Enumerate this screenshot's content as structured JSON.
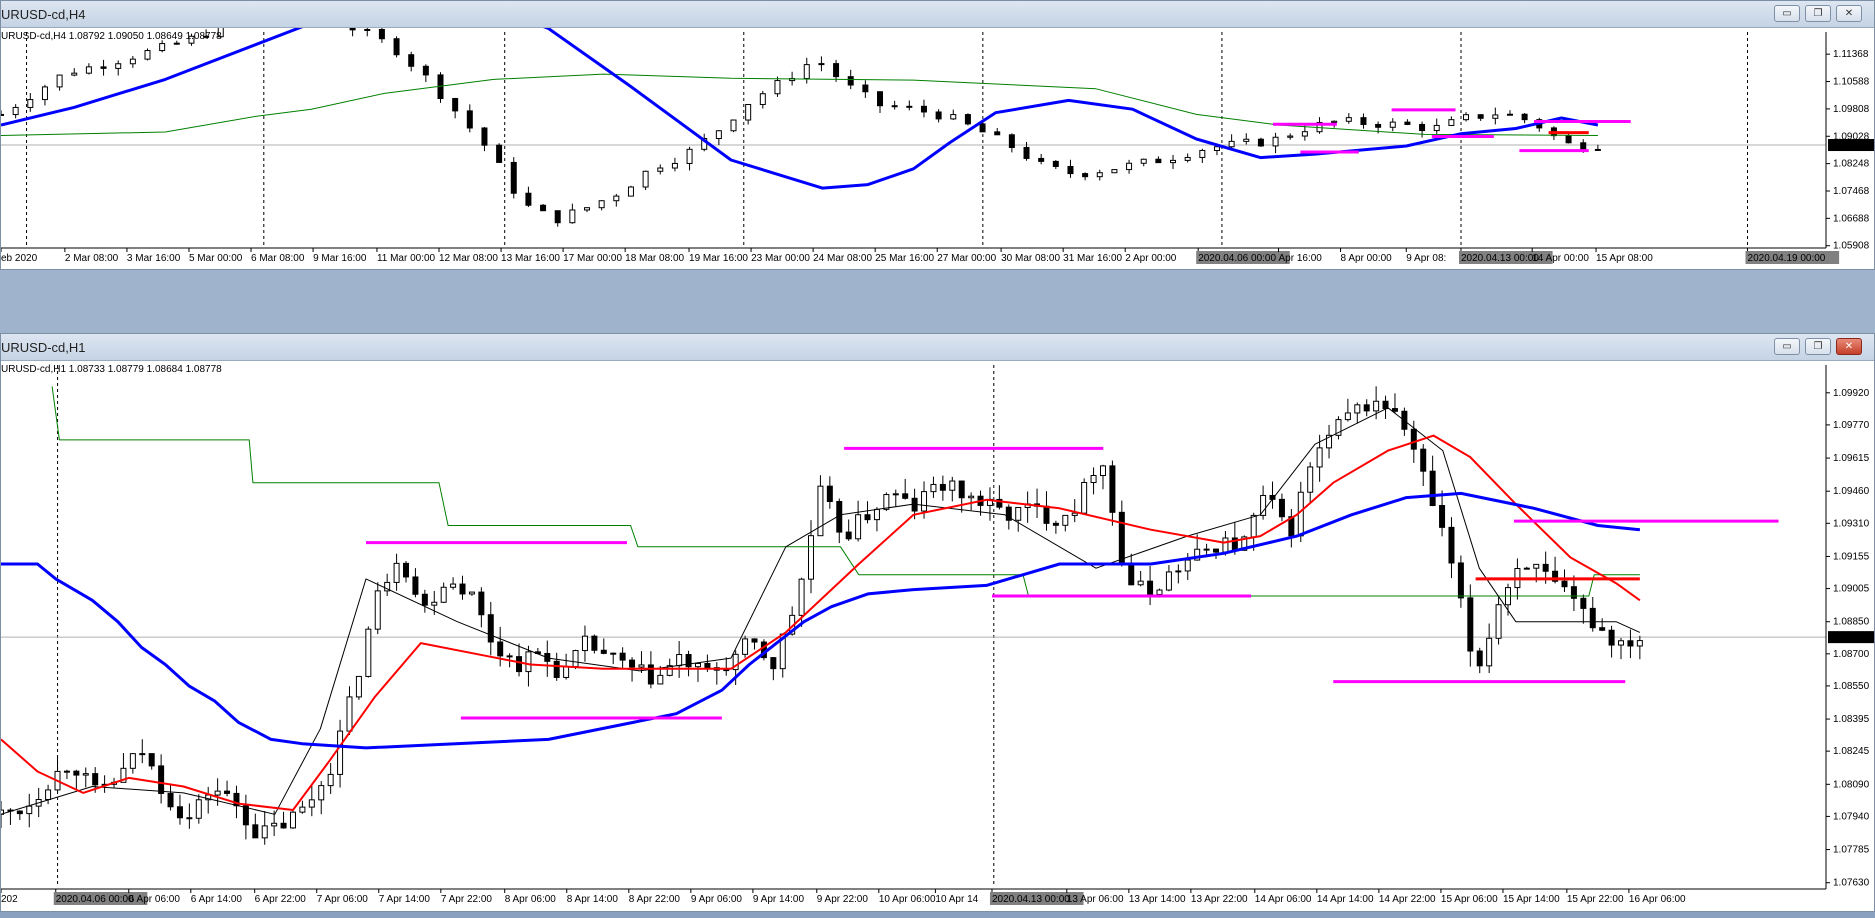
{
  "colors": {
    "bull": "#ffffff",
    "bear": "#000000",
    "ma_blue": "#0000ff",
    "ma_red": "#ff0000",
    "ma_green": "#008000",
    "magenta": "#ff00ff",
    "grid": "#000000",
    "tag_bg": "#808080"
  },
  "top_window": {
    "title": "URUSD-cd,H4",
    "info": "URUSD-cd,H4  1.08792 1.09050 1.08649 1.08778",
    "buttons": {
      "minimize": "▭",
      "restore": "❐",
      "close": "✕"
    },
    "chart_data": {
      "type": "candlestick",
      "symbol": "URUSD-cd,H4",
      "ohlc_last": {
        "open": 1.08792,
        "high": 1.0905,
        "low": 1.08649,
        "close": 1.08778
      },
      "current_price": "1.08778",
      "ylim": [
        1.059,
        1.12
      ],
      "y_ticks": [
        "1.11368",
        "1.10588",
        "1.09808",
        "1.09028",
        "1.08248",
        "1.07468",
        "1.06688",
        "1.05908"
      ],
      "x_ticks": [
        "eb 2020",
        "2 Mar 08:00",
        "3 Mar 16:00",
        "5 Mar 00:00",
        "6 Mar 08:00",
        "9 Mar 16:00",
        "11 Mar 00:00",
        "12 Mar 08:00",
        "13 Mar 16:00",
        "17 Mar 00:00",
        "18 Mar 08:00",
        "19 Mar 16:00",
        "23 Mar 00:00",
        "24 Mar 08:00",
        "25 Mar 16:00",
        "27 Mar 00:00",
        "30 Mar 08:00",
        "31 Mar 16:00",
        "2 Apr 00:00",
        "2020.04.06 00:00",
        "Apr 16:00",
        "8 Apr 00:00",
        "9 Apr 08:",
        "2020.04.13 00:00",
        "14 Apr 00:00",
        "15 Apr 08:00",
        "2020.04.19 00:00"
      ],
      "x_tick_pos": [
        0,
        0.035,
        0.069,
        0.103,
        0.137,
        0.171,
        0.206,
        0.24,
        0.274,
        0.308,
        0.342,
        0.377,
        0.411,
        0.445,
        0.479,
        0.513,
        0.548,
        0.582,
        0.616,
        0.656,
        0.7,
        0.734,
        0.77,
        0.8,
        0.839,
        0.874,
        0.957
      ],
      "highlighted_ticks": [
        "2020.04.06 00:00",
        "2020.04.13 00:00",
        "2020.04.19 00:00"
      ],
      "vlines_frac": [
        0.014,
        0.144,
        0.276,
        0.407,
        0.538,
        0.669,
        0.8,
        0.957
      ],
      "price_path": [
        1.0965,
        1.1025,
        1.1085,
        1.1105,
        1.113,
        1.1155,
        1.1185,
        1.123,
        1.1255,
        1.1245,
        1.124,
        1.1205,
        1.116,
        1.1075,
        1.097,
        1.086,
        1.071,
        1.0665,
        1.07,
        1.0745,
        1.0815,
        1.085,
        1.092,
        1.1005,
        1.106,
        1.1125,
        1.1045,
        1.099,
        1.098,
        1.096,
        1.092,
        1.0875,
        1.0815,
        1.0795,
        1.081,
        1.0825,
        1.0845,
        1.087,
        1.088,
        1.089,
        1.0925,
        1.0945,
        1.094,
        1.0935,
        1.0925,
        1.0955,
        1.097,
        1.0945,
        1.088,
        1.0878
      ],
      "blue_ma": [
        [
          0,
          1.0935
        ],
        [
          0.04,
          1.0985
        ],
        [
          0.09,
          1.1065
        ],
        [
          0.145,
          1.1175
        ],
        [
          0.2,
          1.1285
        ],
        [
          0.25,
          1.131
        ],
        [
          0.3,
          1.121
        ],
        [
          0.345,
          1.1045
        ],
        [
          0.4,
          1.0835
        ],
        [
          0.45,
          1.0755
        ],
        [
          0.475,
          1.0765
        ],
        [
          0.5,
          1.081
        ],
        [
          0.52,
          1.0885
        ],
        [
          0.545,
          1.097
        ],
        [
          0.585,
          1.1005
        ],
        [
          0.62,
          1.098
        ],
        [
          0.655,
          1.0895
        ],
        [
          0.69,
          1.0842
        ],
        [
          0.72,
          1.0852
        ],
        [
          0.77,
          1.0875
        ],
        [
          0.8,
          1.091
        ],
        [
          0.83,
          1.0925
        ],
        [
          0.855,
          1.0955
        ],
        [
          0.875,
          1.0935
        ]
      ],
      "green_line": [
        [
          0,
          1.0905
        ],
        [
          0.09,
          1.0915
        ],
        [
          0.14,
          1.096
        ],
        [
          0.17,
          1.098
        ],
        [
          0.21,
          1.1025
        ],
        [
          0.27,
          1.1065
        ],
        [
          0.33,
          1.108
        ],
        [
          0.4,
          1.1068
        ],
        [
          0.5,
          1.1063
        ],
        [
          0.6,
          1.1038
        ],
        [
          0.655,
          1.0965
        ],
        [
          0.7,
          1.0935
        ],
        [
          0.78,
          1.0908
        ],
        [
          0.875,
          1.0905
        ]
      ],
      "magenta_levels": [
        [
          0.697,
          0.732,
          1.0937
        ],
        [
          0.712,
          0.744,
          1.0858
        ],
        [
          0.762,
          0.797,
          1.0978
        ],
        [
          0.784,
          0.818,
          1.0902
        ],
        [
          0.84,
          0.893,
          1.0945
        ],
        [
          0.832,
          0.87,
          1.0862
        ]
      ],
      "red_levels": [
        [
          0.848,
          0.87,
          1.0913
        ]
      ]
    }
  },
  "bottom_window": {
    "title": "URUSD-cd,H1",
    "info": "URUSD-cd,H1  1.08733 1.08779 1.08684 1.08778",
    "buttons": {
      "minimize": "▭",
      "restore": "❐",
      "close": "✕"
    },
    "chart_data": {
      "type": "candlestick",
      "symbol": "URUSD-cd,H1",
      "ohlc_last": {
        "open": 1.08733,
        "high": 1.08779,
        "low": 1.08684,
        "close": 1.08778
      },
      "current_price": "1.08778",
      "ylim": [
        1.0761,
        1.1005
      ],
      "y_ticks": [
        "1.09920",
        "1.09770",
        "1.09615",
        "1.09460",
        "1.09310",
        "1.09155",
        "1.09005",
        "1.08850",
        "1.08700",
        "1.08550",
        "1.08395",
        "1.08245",
        "1.08090",
        "1.07940",
        "1.07785",
        "1.07630"
      ],
      "x_ticks": [
        "202",
        "2020.04.06 00:00",
        "6 Apr 06:00",
        "6 Apr 14:00",
        "6 Apr 22:00",
        "7 Apr 06:00",
        "7 Apr 14:00",
        "7 Apr 22:00",
        "8 Apr 06:00",
        "8 Apr 14:00",
        "8 Apr 22:00",
        "9 Apr 06:00",
        "9 Apr 14:00",
        "9 Apr 22:00",
        "10 Apr 06:00",
        "10 Apr 14",
        "2020.04.13 00:00",
        "13 Apr 06:00",
        "13 Apr 14:00",
        "13 Apr 22:00",
        "14 Apr 06:00",
        "14 Apr 14:00",
        "14 Apr 22:00",
        "15 Apr 06:00",
        "15 Apr 14:00",
        "15 Apr 22:00",
        "16 Apr 06:00"
      ],
      "x_tick_pos": [
        0,
        0.03,
        0.07,
        0.104,
        0.139,
        0.173,
        0.207,
        0.241,
        0.276,
        0.31,
        0.344,
        0.378,
        0.412,
        0.447,
        0.481,
        0.512,
        0.543,
        0.584,
        0.618,
        0.652,
        0.687,
        0.721,
        0.755,
        0.789,
        0.823,
        0.858,
        0.892
      ],
      "highlighted_ticks": [
        "2020.04.06 00:00",
        "2020.04.13 00:00"
      ],
      "vlines_frac": [
        0.031,
        0.544
      ],
      "price_path": [
        1.0795,
        1.0798,
        1.081,
        1.082,
        1.0805,
        1.0812,
        1.0825,
        1.0805,
        1.0792,
        1.0808,
        1.08,
        1.0785,
        1.079,
        1.0798,
        1.0815,
        1.085,
        1.0895,
        1.0918,
        1.089,
        1.0905,
        1.09,
        1.0875,
        1.0865,
        1.087,
        1.086,
        1.0875,
        1.0868,
        1.0862,
        1.0858,
        1.0868,
        1.086,
        1.0865,
        1.0875,
        1.0865,
        1.0895,
        1.0945,
        1.0925,
        1.0935,
        1.0945,
        1.0938,
        1.095,
        1.0945,
        1.094,
        1.0935,
        1.0938,
        1.0933,
        1.094,
        1.0965,
        1.0905,
        1.0898,
        1.0908,
        1.0915,
        1.0922,
        1.092,
        1.0945,
        1.0925,
        1.096,
        1.0975,
        1.0985,
        1.0988,
        1.0975,
        1.0945,
        1.091,
        1.086,
        1.0895,
        1.0915,
        1.0905,
        1.0895,
        1.0885,
        1.0875,
        1.0878
      ],
      "blue_line": [
        [
          0,
          1.0912
        ],
        [
          0.02,
          1.0912
        ],
        [
          0.03,
          1.0905
        ],
        [
          0.05,
          1.0895
        ],
        [
          0.064,
          1.0885
        ],
        [
          0.077,
          1.0873
        ],
        [
          0.09,
          1.0865
        ],
        [
          0.103,
          1.0855
        ],
        [
          0.117,
          1.0848
        ],
        [
          0.13,
          1.0838
        ],
        [
          0.148,
          1.083
        ],
        [
          0.165,
          1.0828
        ],
        [
          0.2,
          1.0826
        ],
        [
          0.3,
          1.083
        ],
        [
          0.37,
          1.0842
        ],
        [
          0.395,
          1.0853
        ],
        [
          0.41,
          1.0865
        ],
        [
          0.425,
          1.0875
        ],
        [
          0.44,
          1.0885
        ],
        [
          0.455,
          1.0892
        ],
        [
          0.475,
          1.0898
        ],
        [
          0.5,
          1.09
        ],
        [
          0.54,
          1.0902
        ],
        [
          0.58,
          1.0912
        ],
        [
          0.63,
          1.0912
        ],
        [
          0.67,
          1.0917
        ],
        [
          0.71,
          1.0925
        ],
        [
          0.74,
          1.0935
        ],
        [
          0.77,
          1.0943
        ],
        [
          0.8,
          1.0945
        ],
        [
          0.84,
          1.0938
        ],
        [
          0.875,
          1.093
        ],
        [
          0.898,
          1.0928
        ]
      ],
      "green_line": [
        [
          0.028,
          1.0995
        ],
        [
          0.032,
          1.097
        ],
        [
          0.136,
          1.097
        ],
        [
          0.138,
          1.095
        ],
        [
          0.24,
          1.095
        ],
        [
          0.245,
          1.093
        ],
        [
          0.345,
          1.093
        ],
        [
          0.349,
          1.092
        ],
        [
          0.46,
          1.092
        ],
        [
          0.47,
          1.0907
        ],
        [
          0.56,
          1.0907
        ],
        [
          0.563,
          1.0897
        ],
        [
          0.87,
          1.0897
        ],
        [
          0.873,
          1.0907
        ],
        [
          0.898,
          1.0907
        ]
      ],
      "red_ma": [
        [
          0,
          1.083
        ],
        [
          0.02,
          1.0815
        ],
        [
          0.045,
          1.0805
        ],
        [
          0.07,
          1.0812
        ],
        [
          0.1,
          1.0808
        ],
        [
          0.13,
          1.08
        ],
        [
          0.16,
          1.0797
        ],
        [
          0.18,
          1.082
        ],
        [
          0.205,
          1.085
        ],
        [
          0.23,
          1.0875
        ],
        [
          0.26,
          1.087
        ],
        [
          0.29,
          1.0865
        ],
        [
          0.33,
          1.0863
        ],
        [
          0.37,
          1.0863
        ],
        [
          0.4,
          1.0863
        ],
        [
          0.43,
          1.088
        ],
        [
          0.47,
          1.0912
        ],
        [
          0.5,
          1.0935
        ],
        [
          0.54,
          1.0942
        ],
        [
          0.58,
          1.0938
        ],
        [
          0.63,
          1.0928
        ],
        [
          0.67,
          1.0922
        ],
        [
          0.69,
          1.0925
        ],
        [
          0.71,
          1.0935
        ],
        [
          0.73,
          1.095
        ],
        [
          0.76,
          1.0965
        ],
        [
          0.785,
          1.0972
        ],
        [
          0.805,
          1.0962
        ],
        [
          0.83,
          1.094
        ],
        [
          0.86,
          1.0915
        ],
        [
          0.885,
          1.0903
        ],
        [
          0.898,
          1.0895
        ]
      ],
      "black_ma": [
        [
          0,
          1.0795
        ],
        [
          0.05,
          1.0808
        ],
        [
          0.1,
          1.0805
        ],
        [
          0.15,
          1.0795
        ],
        [
          0.175,
          1.0835
        ],
        [
          0.2,
          1.0905
        ],
        [
          0.25,
          1.0885
        ],
        [
          0.3,
          1.0868
        ],
        [
          0.35,
          1.0862
        ],
        [
          0.4,
          1.0868
        ],
        [
          0.43,
          1.092
        ],
        [
          0.46,
          1.0935
        ],
        [
          0.5,
          1.094
        ],
        [
          0.55,
          1.0935
        ],
        [
          0.6,
          1.091
        ],
        [
          0.65,
          1.0925
        ],
        [
          0.69,
          1.0935
        ],
        [
          0.72,
          1.0968
        ],
        [
          0.76,
          1.0985
        ],
        [
          0.79,
          1.0965
        ],
        [
          0.81,
          1.091
        ],
        [
          0.83,
          1.0885
        ],
        [
          0.86,
          1.0885
        ],
        [
          0.885,
          1.0885
        ],
        [
          0.898,
          1.088
        ]
      ],
      "magenta_levels": [
        [
          0.2,
          0.343,
          1.0922
        ],
        [
          0.252,
          0.395,
          1.084
        ],
        [
          0.462,
          0.604,
          1.0966
        ],
        [
          0.543,
          0.685,
          1.0897
        ],
        [
          0.73,
          0.89,
          1.0857
        ],
        [
          0.829,
          0.974,
          1.0932
        ]
      ],
      "red_levels": [
        [
          0.808,
          0.898,
          1.0905
        ]
      ]
    }
  }
}
